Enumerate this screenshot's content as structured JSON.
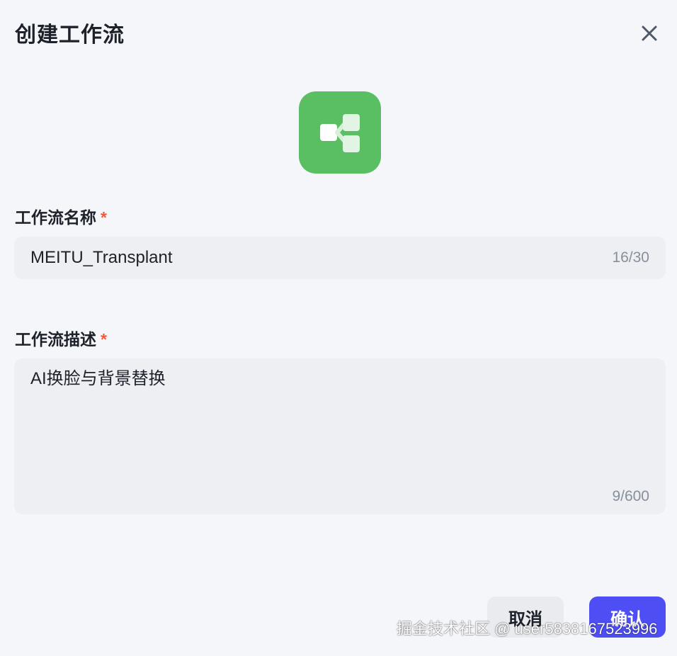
{
  "dialog": {
    "title": "创建工作流",
    "close_icon": "close-icon",
    "app_icon": "workflow-tree-icon",
    "app_icon_color": "#5abf62"
  },
  "name_field": {
    "label": "工作流名称",
    "required_mark": "*",
    "value": "MEITU_Transplant",
    "counter": "16/30"
  },
  "description_field": {
    "label": "工作流描述",
    "required_mark": "*",
    "value": "AI换脸与背景替换",
    "counter": "9/600"
  },
  "footer": {
    "cancel_label": "取消",
    "confirm_label": "确认",
    "confirm_color": "#4e4ef5"
  },
  "watermark": {
    "text": "掘金技术社区 @ user5838167523996"
  }
}
